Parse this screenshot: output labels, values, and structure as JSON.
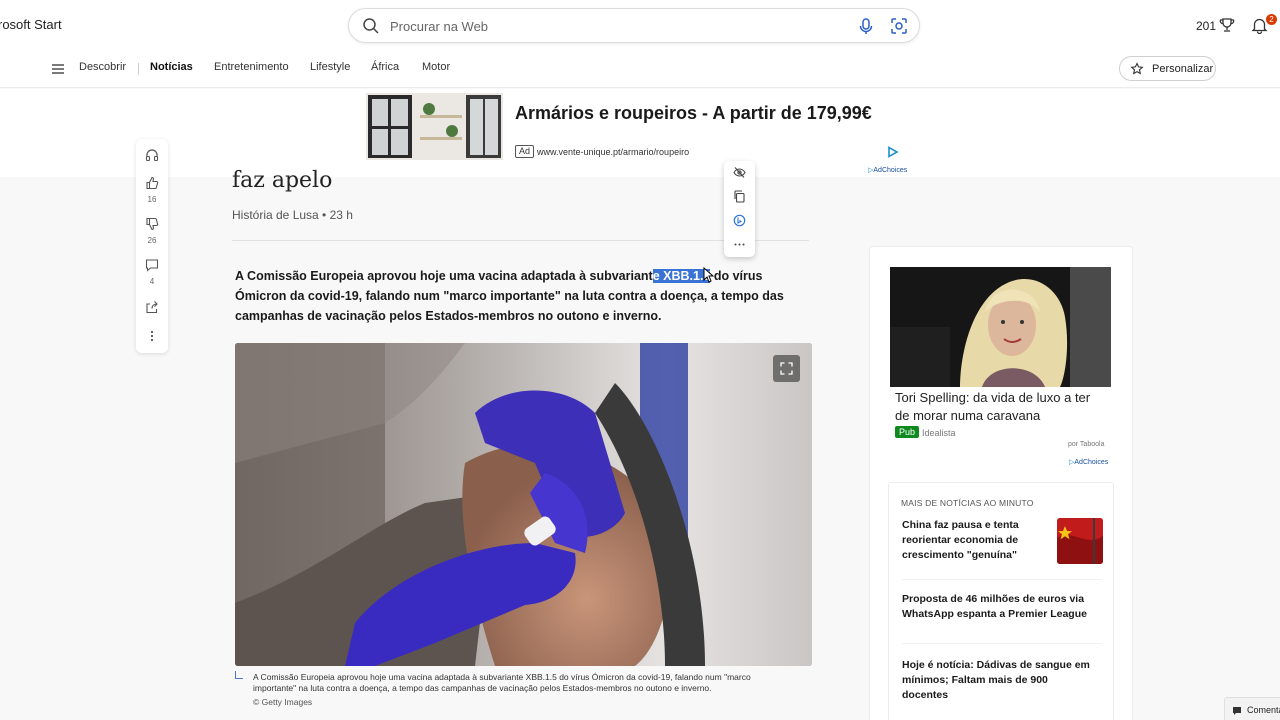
{
  "header": {
    "brand": "rosoft Start",
    "search_placeholder": "Procurar na Web",
    "points": "201",
    "notifications": "2"
  },
  "nav": {
    "items": [
      {
        "label": "Descobrir"
      },
      {
        "label": "Notícias",
        "active": true
      },
      {
        "label": "Entretenimento"
      },
      {
        "label": "Lifestyle"
      },
      {
        "label": "África"
      },
      {
        "label": "Motor"
      }
    ],
    "personalize": "Personalizar"
  },
  "ad": {
    "title": "Armários e roupeiros - A partir de 179,99€",
    "tag": "Ad",
    "url": "www.vente-unique.pt/armario/roupeiro",
    "adchoices": "AdChoices"
  },
  "rail": {
    "likes": "16",
    "dislikes": "26",
    "comments": "4"
  },
  "article": {
    "headline_tail": "faz apelo",
    "byline": "História de Lusa • 23 h",
    "lead_before": "A Comissão Europeia aprovou hoje uma vacina adaptada à subvariant",
    "lead_highlight": "e XBB.1.5",
    "lead_after": " do vírus Ómicron da covid-19, falando num \"marco importante\" na luta contra a doença, a tempo das campanhas de vacinação pelos Estados-membros no outono e inverno.",
    "caption": "A Comissão Europeia aprovou hoje uma vacina adaptada à subvariante XBB.1.5 do vírus Ómicron da covid-19, falando num \"marco importante\" na luta contra a doença, a tempo das campanhas de vacinação pelos Estados-membros no outono e inverno.",
    "credit": "© Getty Images"
  },
  "sidebar": {
    "promo_title": "Tori Spelling: da vida de luxo a ter de morar numa caravana",
    "promo_badge": "Pub",
    "promo_source": "Idealista",
    "promo_provider": "por Taboola",
    "adchoices": "AdChoices",
    "news_heading": "MAIS DE NOTÍCIAS AO MINUTO",
    "news": [
      {
        "title": "China faz pausa e tenta reorientar economia de crescimento \"genuína\""
      },
      {
        "title": "Proposta de 46 milhões de euros via WhatsApp espanta a Premier League"
      },
      {
        "title": "Hoje é notícia: Dádivas de sangue em mínimos; Faltam mais de 900 docentes"
      }
    ]
  },
  "footer": {
    "comment_button": "Comentários"
  },
  "colors": {
    "accent": "#3a73d6",
    "badge": "#d83b01",
    "pub_green": "#0f8a1f"
  }
}
